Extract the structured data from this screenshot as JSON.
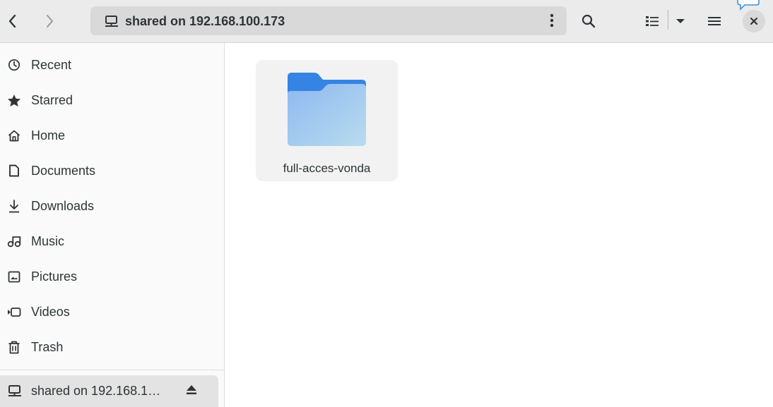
{
  "window": {
    "location": "shared on 192.168.100.173"
  },
  "header": {
    "back_icon": "chevron-left-icon",
    "forward_icon": "chevron-right-icon",
    "search_icon": "search-icon",
    "view_icon": "list-view-icon",
    "view_dropdown_icon": "caret-down-icon",
    "menu_icon": "hamburger-icon",
    "close_icon": "close-icon"
  },
  "sidebar": {
    "items": [
      {
        "label": "Recent",
        "icon": "clock-icon"
      },
      {
        "label": "Starred",
        "icon": "star-icon"
      },
      {
        "label": "Home",
        "icon": "home-icon"
      },
      {
        "label": "Documents",
        "icon": "document-icon"
      },
      {
        "label": "Downloads",
        "icon": "download-icon"
      },
      {
        "label": "Music",
        "icon": "music-icon"
      },
      {
        "label": "Pictures",
        "icon": "picture-icon"
      },
      {
        "label": "Videos",
        "icon": "video-icon"
      },
      {
        "label": "Trash",
        "icon": "trash-icon"
      }
    ],
    "mount": {
      "label": "shared on 192.168.1…",
      "icon": "network-drive-icon",
      "eject_icon": "eject-icon"
    }
  },
  "content": {
    "items": [
      {
        "name": "full-acces-vonda",
        "type": "folder"
      }
    ]
  },
  "colors": {
    "headerbar": "#ebebeb",
    "pathbar": "#d9d9d9",
    "sidebar": "#fafafa",
    "folder_top": "#3584e4",
    "folder_body": "#99c1f1",
    "selected_mount": "#e3e3e3"
  }
}
